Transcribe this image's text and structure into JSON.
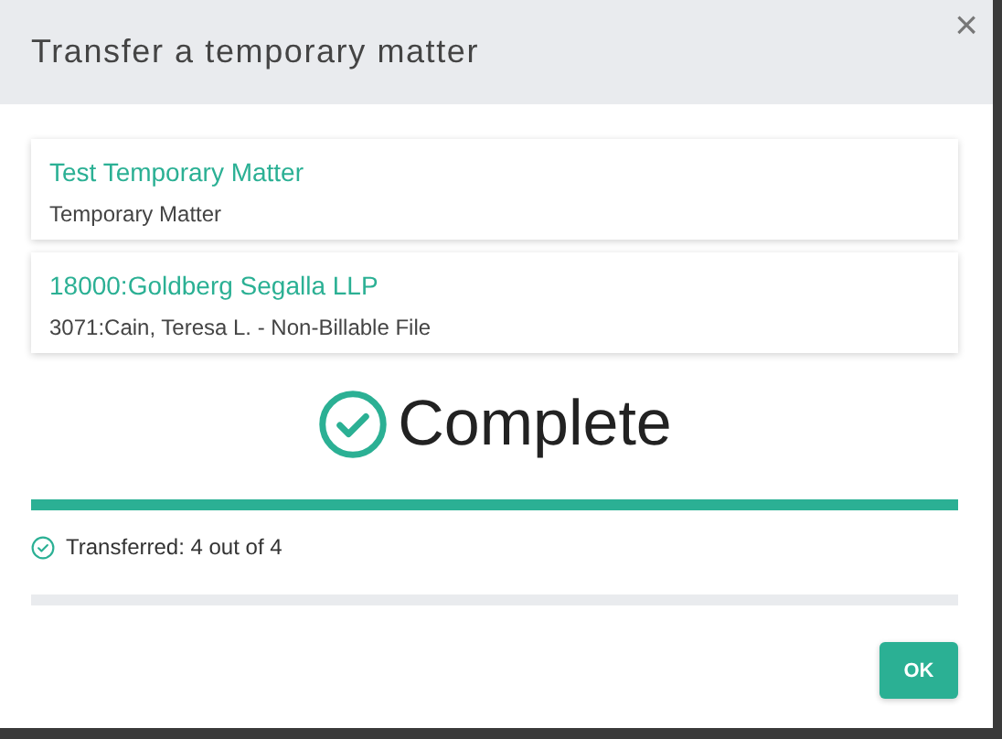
{
  "dialog": {
    "title": "Transfer a temporary matter",
    "close": "×"
  },
  "cards": [
    {
      "title": "Test Temporary Matter",
      "subtitle": "Temporary Matter"
    },
    {
      "title": "18000:Goldberg Segalla LLP",
      "subtitle": "3071:Cain, Teresa L. - Non-Billable File"
    }
  ],
  "status": {
    "heading": "Complete",
    "progress": [
      {
        "level": 1
      }
    ],
    "detail": "Transferred: 4 out of 4"
  },
  "buttons": [
    "OK"
  ]
}
